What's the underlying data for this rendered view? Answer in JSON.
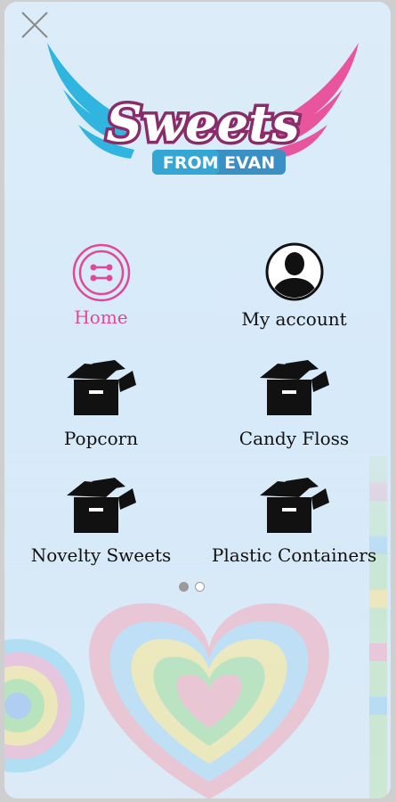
{
  "logo": {
    "title": "Sweets",
    "subtitle": "FROM EVAN"
  },
  "menu": {
    "items": [
      {
        "label": "Home",
        "icon": "home-icon",
        "active": true
      },
      {
        "label": "My account",
        "icon": "user-icon",
        "active": false
      },
      {
        "label": "Popcorn",
        "icon": "box-icon",
        "active": false
      },
      {
        "label": "Candy Floss",
        "icon": "box-icon",
        "active": false
      },
      {
        "label": "Novelty Sweets",
        "icon": "box-icon",
        "active": false
      },
      {
        "label": "Plastic Containers",
        "icon": "box-icon",
        "active": false
      }
    ]
  },
  "pager": {
    "pages": 2,
    "current": 1
  },
  "colors": {
    "accent": "#e0489a",
    "cyan": "#2fb5e0",
    "text": "#111111"
  }
}
